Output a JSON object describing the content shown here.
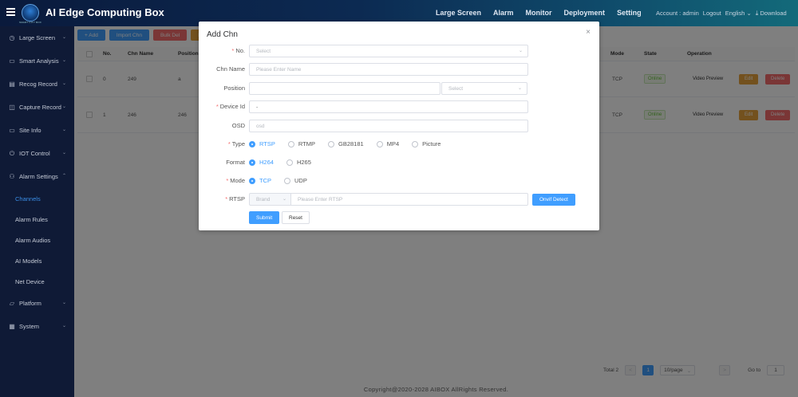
{
  "header": {
    "app_title": "AI Edge Computing Box",
    "logo_subtext": "SMART CITY BOX",
    "nav": [
      "Large Screen",
      "Alarm",
      "Monitor",
      "Deployment",
      "Setting"
    ],
    "account_label": "Account : admin",
    "logout": "Logout",
    "language": "English",
    "download": "Download"
  },
  "sidebar": {
    "items": [
      {
        "label": "Large Screen",
        "icon": "clock-icon",
        "glyph": "◷",
        "chevron": "⌄"
      },
      {
        "label": "Smart Analysis",
        "icon": "monitor-icon",
        "glyph": "▭",
        "chevron": "⌄"
      },
      {
        "label": "Recog Record",
        "icon": "list-icon",
        "glyph": "▤",
        "chevron": "⌄"
      },
      {
        "label": "Capture Record",
        "icon": "camera-icon",
        "glyph": "◫",
        "chevron": "⌄"
      },
      {
        "label": "Site Info",
        "icon": "screen-icon",
        "glyph": "▭",
        "chevron": "⌄"
      },
      {
        "label": "IOT Control",
        "icon": "power-icon",
        "glyph": "⏻",
        "chevron": "⌄"
      },
      {
        "label": "Alarm Settings",
        "icon": "user-icon",
        "glyph": "⚇",
        "chevron": "⌃"
      }
    ],
    "sub_items": [
      "Channels",
      "Alarm Rules",
      "Alarm Audios",
      "AI Models",
      "Net Device"
    ],
    "bottom_items": [
      {
        "label": "Platform",
        "icon": "folder-icon",
        "glyph": "▱",
        "chevron": "⌄"
      },
      {
        "label": "System",
        "icon": "grid-icon",
        "glyph": "▦",
        "chevron": "⌄"
      }
    ]
  },
  "toolbar": {
    "add": "+ Add",
    "import": "Import Chn",
    "bulk_del": "Bulk Del",
    "extra": "E"
  },
  "table": {
    "headers": {
      "no": "No.",
      "name": "Chn Name",
      "position": "Position",
      "mode": "Mode",
      "state": "State",
      "operation": "Operation"
    },
    "rows": [
      {
        "no": "0",
        "name": "249",
        "position": "a",
        "mode": "TCP",
        "state": "Online"
      },
      {
        "no": "1",
        "name": "246",
        "position": "246",
        "mode": "TCP",
        "state": "Online"
      }
    ],
    "ops": {
      "preview": "Video Preview",
      "edit": "Edit",
      "delete": "Delete"
    }
  },
  "pagination": {
    "total": "Total 2",
    "page": "1",
    "per_page": "10/page",
    "goto": "Go to",
    "goto_value": "1",
    "prev": "<",
    "next": ">"
  },
  "footer": "Copyright@2020-2028 AIBOX AllRights Reserved.",
  "dialog": {
    "title": "Add Chn",
    "close": "×",
    "fields": {
      "no": {
        "label": "No.",
        "placeholder": "Select"
      },
      "name": {
        "label": "Chn Name",
        "placeholder": "Please Enter Name"
      },
      "position": {
        "label": "Position",
        "value": "",
        "select_placeholder": "Select"
      },
      "device_id": {
        "label": "Device Id",
        "value": "-"
      },
      "osd": {
        "label": "OSD",
        "value": "osd"
      },
      "type": {
        "label": "Type",
        "options": [
          "RTSP",
          "RTMP",
          "GB28181",
          "MP4",
          "Picture"
        ],
        "selected": 0
      },
      "format": {
        "label": "Format",
        "options": [
          "H264",
          "H265"
        ],
        "selected": 0
      },
      "mode": {
        "label": "Mode",
        "options": [
          "TCP",
          "UDP"
        ],
        "selected": 0
      },
      "rtsp": {
        "label": "RTSP",
        "brand": "Brand",
        "placeholder": "Please Enter RTSP",
        "onvif": "Onvif Detect"
      }
    },
    "submit": "Submit",
    "reset": "Reset"
  },
  "colors": {
    "primary": "#409eff",
    "danger": "#f56c6c",
    "warning": "#e6a23c",
    "sidebar": "#0f1a36"
  }
}
